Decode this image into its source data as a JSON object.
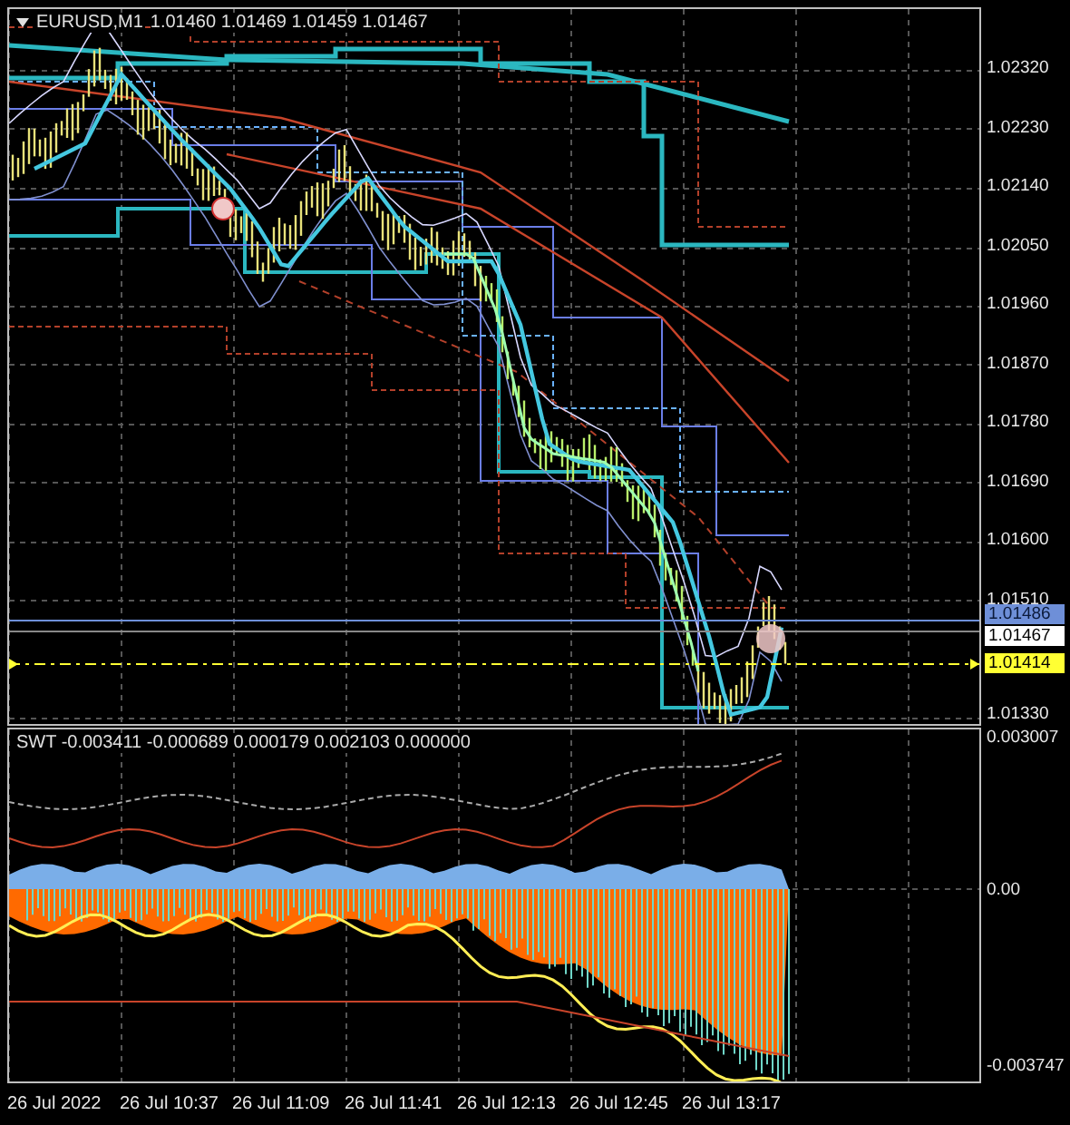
{
  "main_chart": {
    "legend": {
      "symbol": "EURUSD,M1",
      "values": "1.01460 1.01469 1.01459 1.01467"
    },
    "price_axis": [
      "1.02320",
      "1.02230",
      "1.02140",
      "1.02050",
      "1.01960",
      "1.01870",
      "1.01780",
      "1.01690",
      "1.01600",
      "1.01510",
      "1.01330"
    ],
    "price_tags": [
      {
        "kind": "line",
        "text": "1.01486"
      },
      {
        "kind": "close",
        "text": "1.01467"
      },
      {
        "kind": "alert",
        "text": "1.01414"
      }
    ]
  },
  "indicator": {
    "legend": "SWT -0.003411 -0.000689 0.000179 0.002103 0.000000",
    "axis": [
      "0.003007",
      "0.00",
      "-0.003747"
    ]
  },
  "time_axis": [
    "26 Jul 2022",
    "26 Jul 10:37",
    "26 Jul 11:09",
    "26 Jul 11:41",
    "26 Jul 12:13",
    "26 Jul 12:45",
    "26 Jul 13:17"
  ]
}
